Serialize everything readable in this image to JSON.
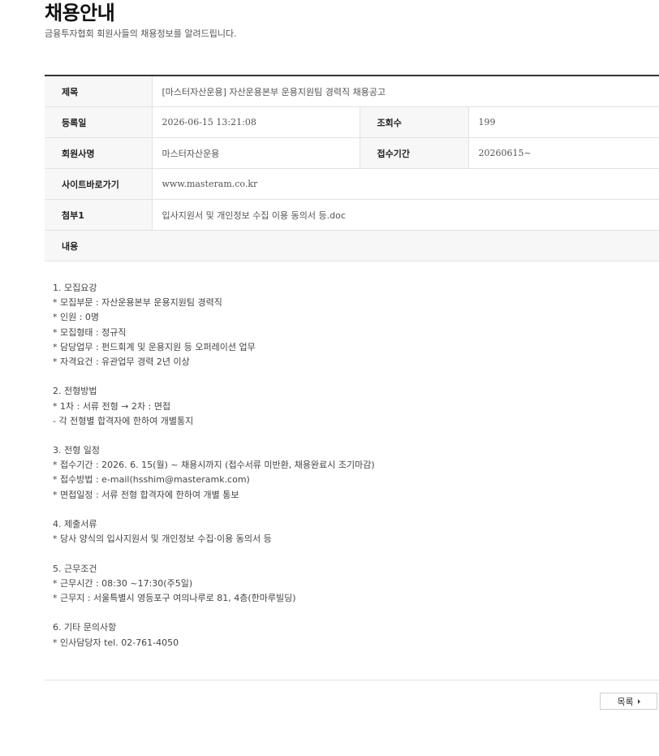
{
  "header": {
    "title": "채용안내",
    "subtitle": "금융투자협회 회원사들의 채용정보를 알려드립니다."
  },
  "detail": {
    "subject_label": "제목",
    "subject": "[마스터자산운용] 자산운용본부 운용지원팀 경력직 채용공고",
    "date_label": "등록일",
    "date": "2026-06-15 13:21:08",
    "views_label": "조회수",
    "views": "199",
    "company_label": "회원사명",
    "company": "마스터자산운용",
    "period_label": "접수기간",
    "period": "20260615~",
    "site_label": "사이트바로가기",
    "site": "www.masteram.co.kr",
    "attach_label": "첨부1",
    "attach": "입사지원서 및 개인정보 수집 이용 동의서 등.doc",
    "content_label": "내용"
  },
  "content": [
    "1. 모집요강",
    "* 모집부문 : 자산운용본부 운용지원팀 경력직",
    "* 인원 : 0명",
    "* 모집형태 : 정규직",
    "* 담당업무 : 펀드회계 및 운용지원 등 오퍼레이션 업무",
    "* 자격요건 : 유관업무 경력 2년 이상",
    "",
    "2. 전형방법",
    "* 1차 : 서류 전형 → 2차 : 면접",
    "- 각 전형별 합격자에 한하여 개별통지",
    "",
    "3. 전형 일정",
    "* 접수기간 : 2026. 6. 15(월) ~ 채용시까지 (접수서류 미반환, 채용완료시 조기마감)",
    "* 접수방법 : e-mail(hsshim@masteramk.com)",
    "* 면접일정 : 서류 전형 합격자에 한하여 개별 통보",
    "",
    "4. 제출서류",
    "* 당사 양식의 입사지원서 및 개인정보 수집·이용 동의서 등",
    "",
    "5. 근무조건",
    "* 근무시간 : 08:30 ~17:30(주5일)",
    "* 근무지 : 서울특별시 영등포구 여의나루로 81, 4층(한마루빌딩)",
    "",
    "6. 기타 문의사항",
    "* 인사담당자 tel. 02-761-4050"
  ],
  "footer": {
    "list_button": "목록"
  }
}
